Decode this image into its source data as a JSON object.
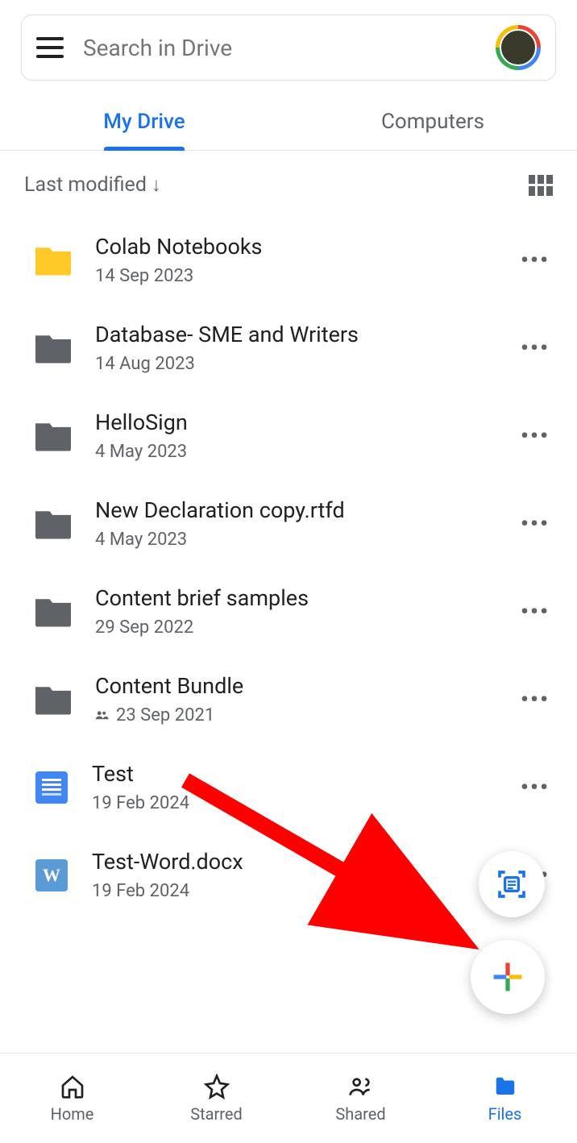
{
  "search": {
    "placeholder": "Search in Drive"
  },
  "tabs": [
    {
      "label": "My Drive",
      "active": true
    },
    {
      "label": "Computers",
      "active": false
    }
  ],
  "sort": {
    "label": "Last modified",
    "direction": "down"
  },
  "files": [
    {
      "name": "Colab Notebooks",
      "date": "14 Sep 2023",
      "icon": "folder-yellow",
      "shared": false
    },
    {
      "name": "Database- SME and Writers",
      "date": "14 Aug 2023",
      "icon": "folder-gray",
      "shared": false
    },
    {
      "name": "HelloSign",
      "date": "4 May 2023",
      "icon": "folder-gray",
      "shared": false
    },
    {
      "name": "New Declaration copy.rtfd",
      "date": "4 May 2023",
      "icon": "folder-gray",
      "shared": false
    },
    {
      "name": "Content brief samples",
      "date": "29 Sep 2022",
      "icon": "folder-gray",
      "shared": false
    },
    {
      "name": "Content Bundle",
      "date": "23 Sep 2021",
      "icon": "folder-gray",
      "shared": true
    },
    {
      "name": "Test",
      "date": "19 Feb 2024",
      "icon": "doc-blue",
      "shared": false
    },
    {
      "name": "Test-Word.docx",
      "date": "19 Feb 2024",
      "icon": "doc-w",
      "shared": false
    }
  ],
  "nav": [
    {
      "label": "Home",
      "icon": "home",
      "active": false
    },
    {
      "label": "Starred",
      "icon": "star",
      "active": false
    },
    {
      "label": "Shared",
      "icon": "people",
      "active": false
    },
    {
      "label": "Files",
      "icon": "folder",
      "active": true
    }
  ],
  "colors": {
    "primary": "#1a73e8",
    "text": "#202124",
    "subtext": "#5f6368"
  }
}
